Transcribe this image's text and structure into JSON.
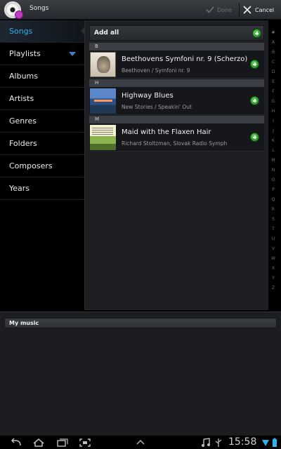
{
  "actionbar": {
    "title": "Songs",
    "done_label": "Done",
    "cancel_label": "Cancel"
  },
  "nav": {
    "items": [
      {
        "label": "Songs",
        "selected": true
      },
      {
        "label": "Playlists"
      },
      {
        "label": "Albums"
      },
      {
        "label": "Artists"
      },
      {
        "label": "Genres"
      },
      {
        "label": "Folders"
      },
      {
        "label": "Composers"
      },
      {
        "label": "Years"
      }
    ]
  },
  "list": {
    "add_all_label": "Add all",
    "sections": [
      {
        "letter": "B"
      },
      {
        "letter": "H"
      },
      {
        "letter": "M"
      }
    ],
    "songs": [
      {
        "title": "Beethovens Symfoni nr. 9 (Scherzo)",
        "subtitle": "Beethoven / Symfoni nr. 9"
      },
      {
        "title": "Highway Blues",
        "subtitle": "New Stories / Speakin' Out"
      },
      {
        "title": "Maid with the Flaxen Hair",
        "subtitle": "Richard Stoltzman, Slovak Radio Symph"
      }
    ]
  },
  "index_letters": [
    "#",
    "A",
    "B",
    "C",
    "D",
    "E",
    "F",
    "G",
    "H",
    "I",
    "J",
    "K",
    "L",
    "M",
    "N",
    "O",
    "P",
    "Q",
    "R",
    "S",
    "T",
    "U",
    "V",
    "W",
    "X",
    "Y",
    "Z"
  ],
  "my_music": {
    "header": "My music"
  },
  "status": {
    "time": "15:58"
  },
  "colors": {
    "accent": "#2fb1ea",
    "add_green": "#3cb83c"
  }
}
